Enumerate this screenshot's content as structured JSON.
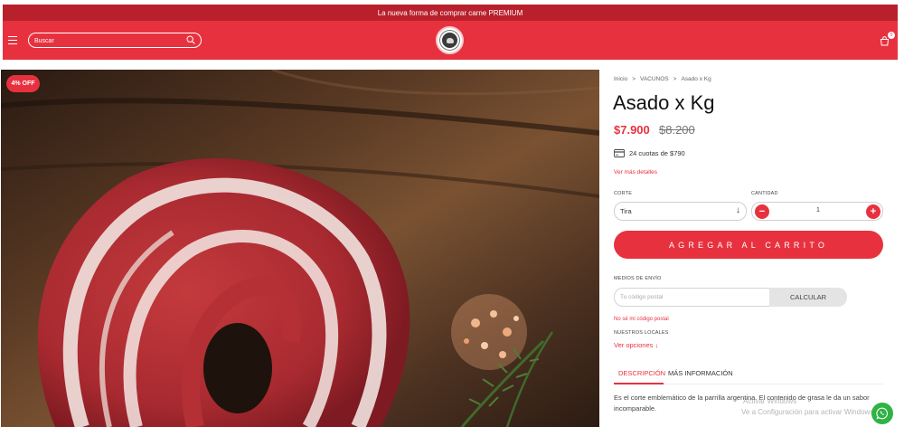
{
  "announcement": "La nueva forma de comprar carne PREMIUM",
  "header": {
    "search_placeholder": "Buscar",
    "cart_count": "0"
  },
  "product": {
    "discount_badge": "4% OFF",
    "breadcrumb": [
      "Inicio",
      "VACUNOS",
      "Asado x Kg"
    ],
    "title": "Asado x Kg",
    "price": "$7.900",
    "price_old": "$8.200",
    "installments": "24 cuotas de $790",
    "details_link": "Ver más detalles",
    "cut_label": "CORTE",
    "cut_value": "Tira",
    "qty_label": "CANTIDAD",
    "qty_value": "1",
    "minus": "−",
    "plus": "+",
    "add_to_cart": "AGREGAR AL CARRITO"
  },
  "shipping": {
    "label": "MEDIOS DE ENVÍO",
    "placeholder": "Tu código postal",
    "calc_button": "CALCULAR",
    "no_postal": "No sé mi código postal",
    "stores_label": "NUESTROS LOCALES",
    "options_link": "Ver opciones ↓"
  },
  "tabs": [
    {
      "label": "DESCRIPCIÓN"
    },
    {
      "label": "MÁS INFORMACIÓN"
    }
  ],
  "description": "Es el corte emblemático de la parrilla argentina. El contenido de grasa le da un sabor incomparable.",
  "watermark": [
    "Activar Windows",
    "Ve a Configuración para activar Windows."
  ],
  "colors": {
    "accent": "#e8313f",
    "announce_bar": "#b8202c",
    "whatsapp": "#2fb344"
  }
}
